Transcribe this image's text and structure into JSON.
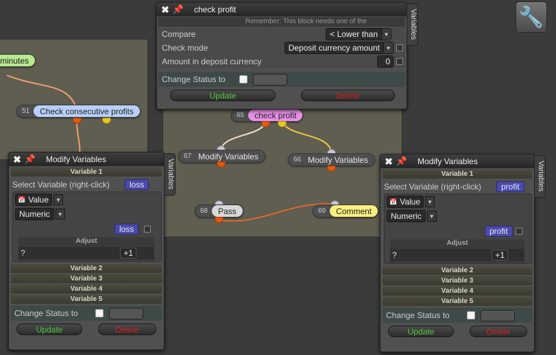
{
  "nodes": {
    "minutes": {
      "label": "minutes"
    },
    "n51": {
      "num": "51",
      "label": "Check consecutive profits"
    },
    "n65": {
      "num": "65",
      "label": "check profit"
    },
    "n67": {
      "num": "67",
      "label": "Modify Variables"
    },
    "n66": {
      "num": "66",
      "label": "Modify Variables"
    },
    "n68": {
      "num": "68",
      "label": "Pass"
    },
    "n69": {
      "num": "69",
      "label": "Comment"
    }
  },
  "check_profit": {
    "title": "check profit",
    "tab": "Variables",
    "notice": "Remember: This block needs one of the",
    "compare_label": "Compare",
    "compare_value": "< Lower than",
    "check_mode_label": "Check mode",
    "check_mode_value": "Deposit currency amount",
    "amount_label": "Amount in deposit currency",
    "amount_value": "0",
    "change_status": "Change Status to",
    "update": "Update",
    "delete": "Delete"
  },
  "mod_left": {
    "title": "Modify Variables",
    "tab": "Variables",
    "var1": "Variable 1",
    "select_label": "Select Variable (right-click)",
    "selected": "loss",
    "value_type": "Value",
    "numeric": "Numeric",
    "value_tag": "loss",
    "adjust": "Adjust",
    "adjust_q": "?",
    "adjust_val": "+1",
    "vars": [
      "Variable 2",
      "Variable 3",
      "Variable 4",
      "Variable 5"
    ],
    "change_status": "Change Status to",
    "update": "Update",
    "delete": "Delete"
  },
  "mod_right": {
    "title": "Modify Variables",
    "tab": "Variables",
    "var1": "Variable 1",
    "select_label": "Select Variable (right-click)",
    "selected": "profit",
    "value_type": "Value",
    "numeric": "Numeric",
    "value_tag": "profit",
    "adjust": "Adjust",
    "adjust_q": "?",
    "adjust_val": "+1",
    "vars": [
      "Variable 2",
      "Variable 3",
      "Variable 4",
      "Variable 5"
    ],
    "change_status": "Change Status to",
    "update": "Update",
    "delete": "Delete"
  },
  "colors": {
    "canvas": "#5f5e50",
    "window": "#505050",
    "tag": "#4a4aa8",
    "green": "#52c840",
    "red": "#d42020"
  },
  "icons": [
    "close-icon",
    "pin-icon",
    "wrench-icon",
    "calendar-icon",
    "chevron-down-icon"
  ]
}
